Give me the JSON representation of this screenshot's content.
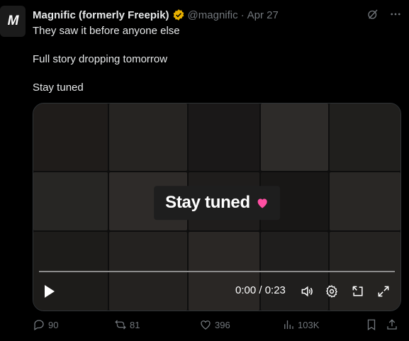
{
  "author": {
    "avatar_letter": "M",
    "name": "Magnific (formerly Freepik)",
    "handle": "@magnific",
    "separator": "·",
    "date": "Apr 27"
  },
  "tweet": {
    "lines": [
      "They saw it before anyone else",
      "Full story dropping tomorrow",
      "Stay tuned"
    ]
  },
  "video": {
    "overlay_text": "Stay tuned",
    "time": "0:00 / 0:23"
  },
  "actions": {
    "replies": "90",
    "reposts": "81",
    "likes": "396",
    "views": "103K"
  },
  "colors": {
    "background": "#000000",
    "text": "#e7e9ea",
    "muted": "#71767b",
    "heart": "#ff4fa3",
    "verified": "#e8b000"
  }
}
